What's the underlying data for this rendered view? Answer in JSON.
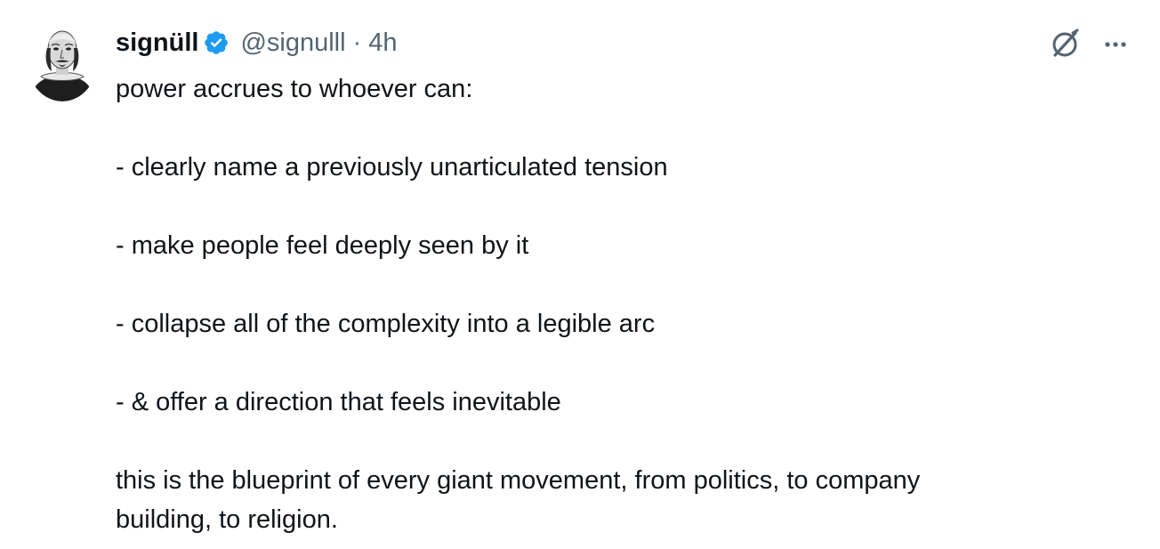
{
  "tweet": {
    "display_name": "signüll",
    "handle": "@signulll",
    "separator": "·",
    "time": "4h",
    "verified": true,
    "accent_color": "#1d9bf0",
    "lines": [
      "power accrues to whoever can:",
      "- clearly name a previously unarticulated tension",
      "- make people feel deeply seen by it",
      "- collapse all of the complexity into a legible arc",
      "- & offer a direction that feels inevitable",
      "this is the blueprint of every giant movement, from politics, to company",
      "building, to religion."
    ],
    "icons": {
      "verified": "verified-badge-icon",
      "grok": "grok-icon",
      "more": "more-options-icon"
    }
  }
}
